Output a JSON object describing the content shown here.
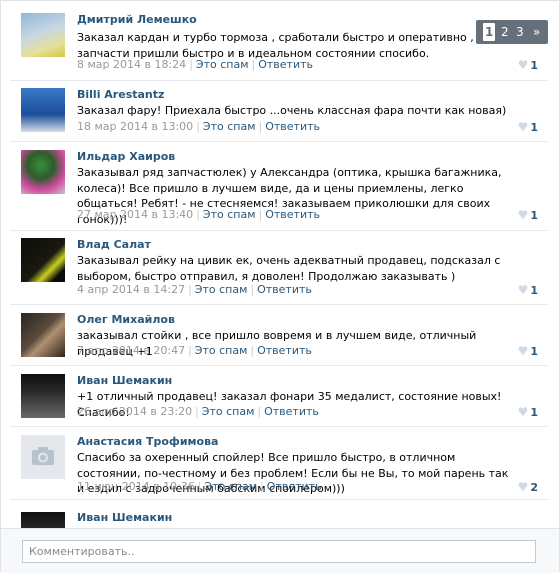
{
  "comments": [
    {
      "author": "Дмитрий Лемешко",
      "text": "Заказал кардан и турбо тормоза , сработали быстро и оперативно , запчасти пришли быстро и в идеальном состоянии спосибо.",
      "date": "8 мар 2014 в 18:24",
      "spam": "Это спам",
      "reply": "Ответить",
      "likes": "1"
    },
    {
      "author": "Billi Arestantz",
      "text": "Заказал фару! Приехала быстро ...очень классная фара почти как новая)",
      "date": "18 мар 2014 в 13:00",
      "spam": "Это спам",
      "reply": "Ответить",
      "likes": "1"
    },
    {
      "author": "Ильдар Хаиров",
      "text": "Заказывал ряд запчастюлек) у Александра (оптика, крышка багажника, колеса)! Все пришло в лучшем виде, да и цены приемлены, легко общаться! Ребят! - не стесняемся! заказываем приколюшки для своих гонок)))!",
      "date": "27 мар 2014 в 13:40",
      "spam": "Это спам",
      "reply": "Ответить",
      "likes": "1"
    },
    {
      "author": "Влад Салат",
      "text": "Заказывал рейку на цивик ек, очень адекватный продавец, подсказал с выбором, быстро отправил, я доволен! Продолжаю заказывать )",
      "date": "4 апр 2014 в 14:27",
      "spam": "Это спам",
      "reply": "Ответить",
      "likes": "1"
    },
    {
      "author": "Олег Михайлов",
      "text": "заказывал стойки , все пришло вовремя и в лучшем виде, отличный продавец +1",
      "date": "7 апр 2014 в 20:47",
      "spam": "Это спам",
      "reply": "Ответить",
      "likes": "1"
    },
    {
      "author": "Иван Шемакин",
      "text": "+1 отличный продавец! заказал фонари 35 медалист, состояние новых! Спасибо!",
      "date": "26 апр 2014 в 23:20",
      "spam": "Это спам",
      "reply": "Ответить",
      "likes": "1"
    },
    {
      "author": "Анастасия Трофимова",
      "text": "Спасибо за охеренный спойлер! Все пришло быстро, в отличном состоянии, по-честному и без проблем! Если бы не Вы, то мой парень так и ездил с задроченным бабским спойлером)))",
      "date": "11 июн 2014 в 10:36",
      "spam": "Это спам",
      "reply": "Ответить",
      "likes": "2"
    },
    {
      "author": "Иван Шемакин"
    }
  ],
  "pager": {
    "pages": [
      "1",
      "2",
      "3"
    ],
    "current": "1",
    "next": "»"
  },
  "composer": {
    "placeholder": "Комментировать.."
  },
  "colors": {
    "link": "#2b587a",
    "meta": "#999999",
    "pager_bg": "#5a6470"
  }
}
